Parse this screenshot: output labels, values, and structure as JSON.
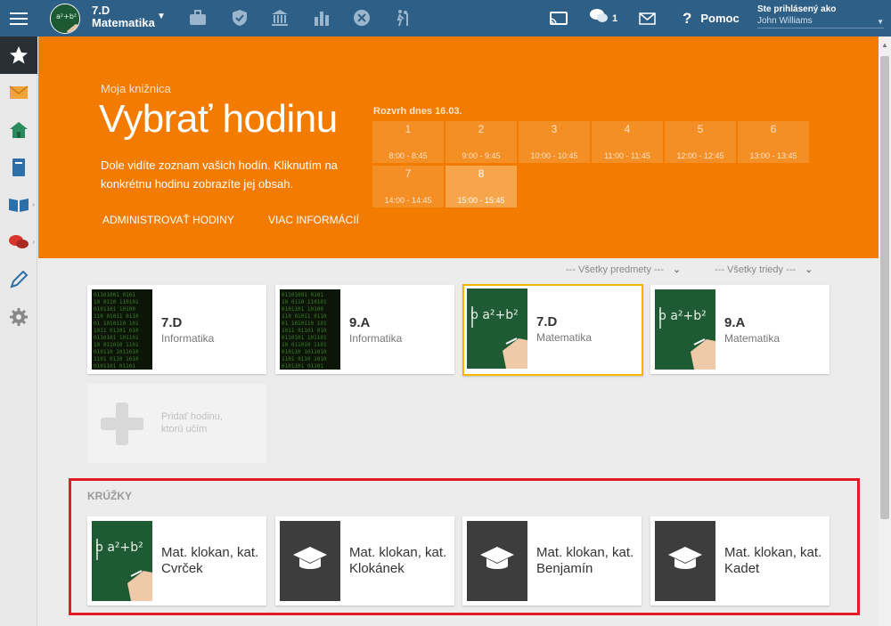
{
  "topbar": {
    "menu_icon": "hamburger-icon",
    "class_title": "7.D",
    "class_subject": "Matematika",
    "tools": [
      "briefcase-icon",
      "shield-check-icon",
      "bank-icon",
      "bar-chart-icon",
      "tools-icon",
      "hiking-icon"
    ],
    "cast_icon": "cast-icon",
    "messages_count": "1",
    "help_label": "Pomoc",
    "help_symbol": "?",
    "login_label": "Ste prihlásený ako",
    "login_user": "John Williams"
  },
  "sidebar": {
    "items": [
      "star-icon",
      "mail-icon",
      "home-icon",
      "notebook-icon",
      "book-icon",
      "chat-icon",
      "pen-icon",
      "gear-icon"
    ]
  },
  "hero": {
    "kicker": "Moja knižnica",
    "title": "Vybrať hodinu",
    "description": "Dole vidíte zoznam vašich hodín. Kliknutím na konkrétnu hodinu zobrazíte jej obsah.",
    "link_admin": "ADMINISTROVAŤ HODINY",
    "link_info": "VIAC INFORMÁCIÍ",
    "schedule_title": "Rozvrh dnes 16.03.",
    "slots": [
      {
        "num": "1",
        "time": "8:00 - 8:45"
      },
      {
        "num": "2",
        "time": "9:00 - 9:45"
      },
      {
        "num": "3",
        "time": "10:00 - 10:45"
      },
      {
        "num": "4",
        "time": "11:00 - 11:45"
      },
      {
        "num": "5",
        "time": "12:00 - 12:45"
      },
      {
        "num": "6",
        "time": "13:00 - 13:45"
      },
      {
        "num": "7",
        "time": "14:00 - 14:45"
      },
      {
        "num": "8",
        "time": "15:00 - 15:45"
      }
    ]
  },
  "filters": {
    "subjects": "--- Všetky predmety ---",
    "classes": "--- Všetky triedy ---"
  },
  "lessons": [
    {
      "title": "7.D",
      "subject": "Informatika"
    },
    {
      "title": "9.A",
      "subject": "Informatika"
    },
    {
      "title": "7.D",
      "subject": "Matematika"
    },
    {
      "title": "9.A",
      "subject": "Matematika"
    }
  ],
  "add_lesson": "Pridať hodinu, ktorú učím",
  "clubs": {
    "label": "KRÚŽKY",
    "items": [
      {
        "name": "Mat. klokan, kat. Cvrček"
      },
      {
        "name": "Mat. klokan, kat. Klokánek"
      },
      {
        "name": "Mat. klokan, kat. Benjamín"
      },
      {
        "name": "Mat. klokan, kat. Kadet"
      }
    ]
  },
  "colors": {
    "topbar": "#2e5f86",
    "hero": "#f27b00",
    "selected_border": "#f5b800",
    "highlight_box": "#e31b23"
  }
}
